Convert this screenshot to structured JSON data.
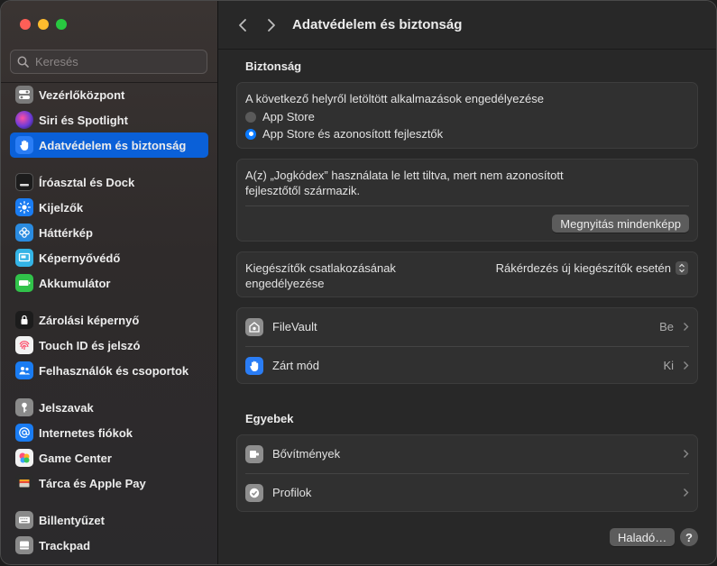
{
  "window": {
    "title": "Adatvédelem és biztonság"
  },
  "search": {
    "placeholder": "Keresés",
    "value": ""
  },
  "sidebar": {
    "items": [
      {
        "label": "Vezérlőközpont",
        "icon": "control-center-icon",
        "color": "#7a7a7a"
      },
      {
        "label": "Siri és Spotlight",
        "icon": "siri-icon",
        "color": "#8e3ad6"
      },
      {
        "label": "Adatvédelem és biztonság",
        "icon": "hand-icon",
        "color": "#1a6ef0",
        "active": true
      },
      {
        "label": "Íróasztal és Dock",
        "icon": "dock-icon",
        "color": "#1c1c1c"
      },
      {
        "label": "Kijelzők",
        "icon": "sun-icon",
        "color": "#1a7cf2"
      },
      {
        "label": "Háttérkép",
        "icon": "wallpaper-icon",
        "color": "#2a8be0"
      },
      {
        "label": "Képernyővédő",
        "icon": "screensaver-icon",
        "color": "#34b4e6"
      },
      {
        "label": "Akkumulátor",
        "icon": "battery-icon",
        "color": "#31c24a"
      },
      {
        "label": "Zárolási képernyő",
        "icon": "lock-screen-icon",
        "color": "#1c1c1c"
      },
      {
        "label": "Touch ID és jelszó",
        "icon": "fingerprint-icon",
        "color": "#f2f2f2"
      },
      {
        "label": "Felhasználók és csoportok",
        "icon": "users-icon",
        "color": "#1a7cf2"
      },
      {
        "label": "Jelszavak",
        "icon": "key-icon",
        "color": "#8a8a8a"
      },
      {
        "label": "Internetes fiókok",
        "icon": "at-icon",
        "color": "#1a7cf2"
      },
      {
        "label": "Game Center",
        "icon": "game-center-icon",
        "color": "#f2f2f2"
      },
      {
        "label": "Tárca és Apple Pay",
        "icon": "wallet-icon",
        "color": "#2b2b2b"
      },
      {
        "label": "Billentyűzet",
        "icon": "keyboard-icon",
        "color": "#8a8a8a"
      },
      {
        "label": "Trackpad",
        "icon": "trackpad-icon",
        "color": "#8a8a8a"
      }
    ]
  },
  "main": {
    "security": {
      "heading": "Biztonság",
      "allow_label": "A következő helyről letöltött alkalmazások engedélyezése",
      "options": [
        {
          "label": "App Store",
          "selected": false
        },
        {
          "label": "App Store és azonosított fejlesztők",
          "selected": true
        }
      ],
      "blocked_line1": "A(z) „Jogkódex” használata le lett tiltva, mert nem azonosított",
      "blocked_line2": "fejlesztőtől származik.",
      "open_anyway": "Megnyitás mindenképp",
      "accessories_line1": "Kiegészítők csatlakozásának",
      "accessories_line2": "engedélyezése",
      "accessories_value": "Rákérdezés új kiegészítők esetén",
      "filevault": {
        "label": "FileVault",
        "value": "Be"
      },
      "lockdown": {
        "label": "Zárt mód",
        "value": "Ki"
      }
    },
    "others": {
      "heading": "Egyebek",
      "extensions": "Bővítmények",
      "profiles": "Profilok"
    },
    "advanced_button": "Haladó…",
    "help_button": "?"
  },
  "colors": {
    "accent": "#0a60d8",
    "window_bg": "#282828",
    "card_bg": "#303030"
  }
}
